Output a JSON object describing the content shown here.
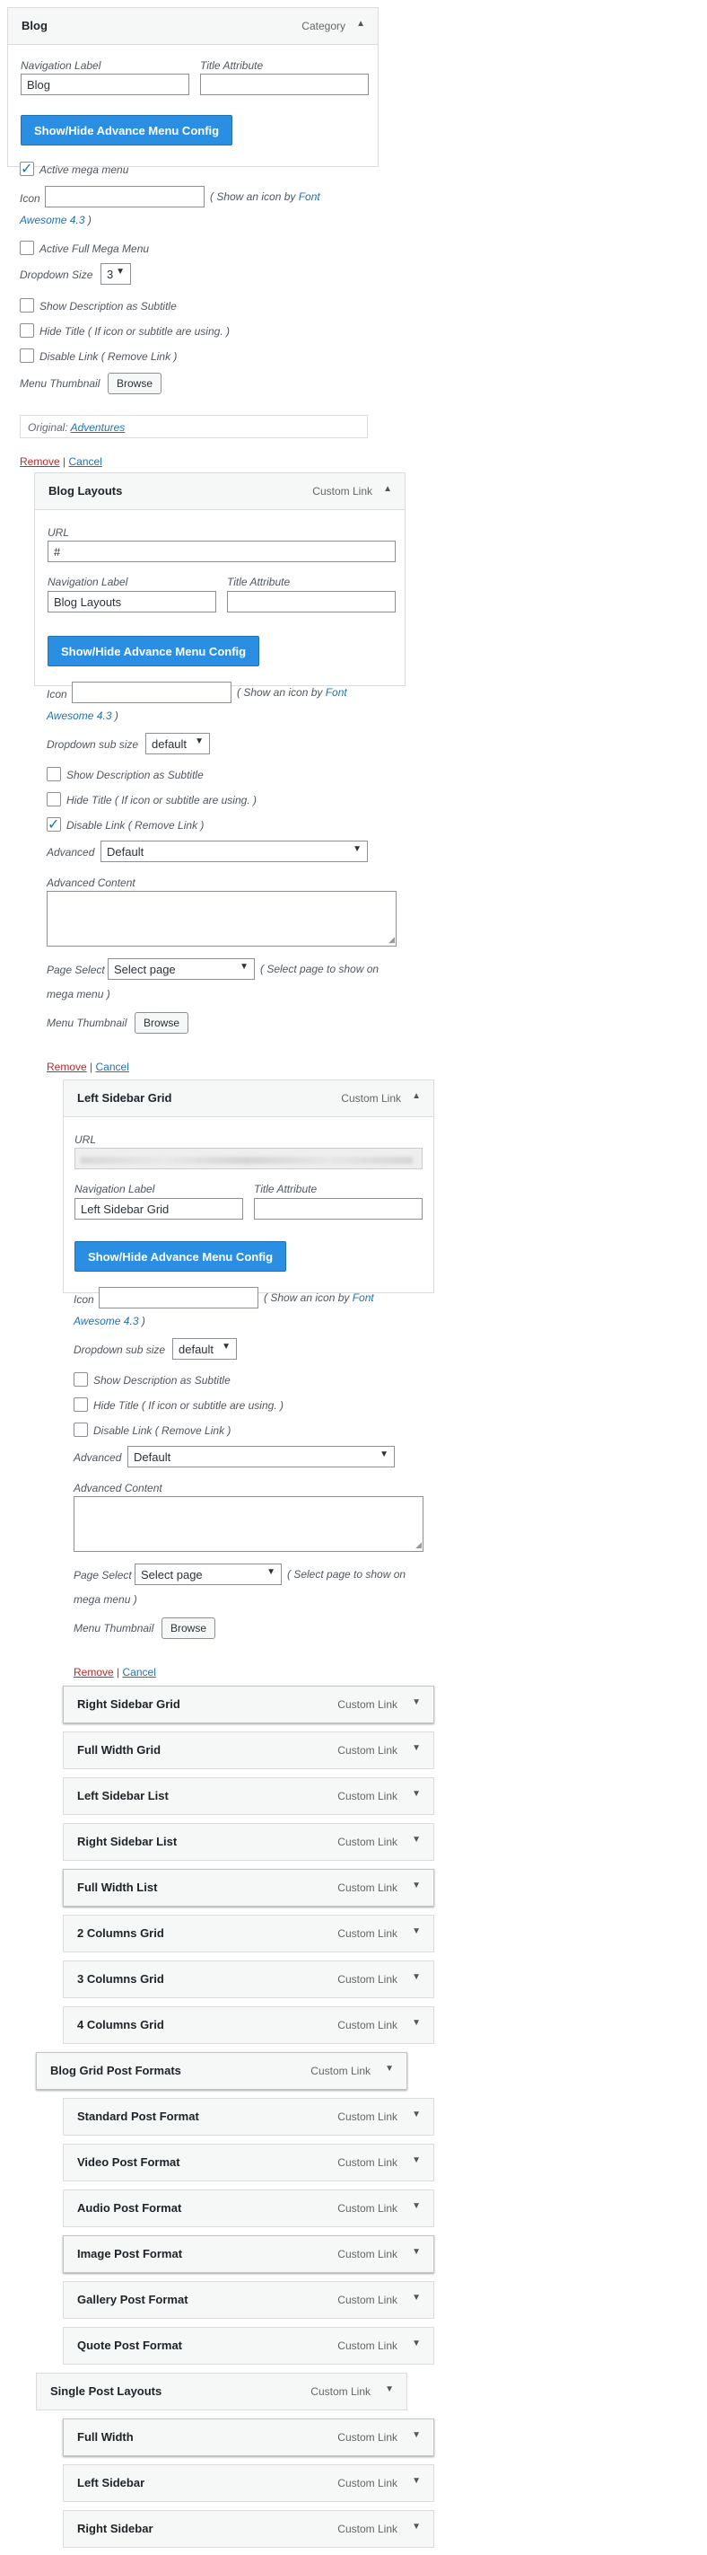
{
  "blog": {
    "title": "Blog",
    "type": "Category",
    "nav_label_lbl": "Navigation Label",
    "nav_label_val": "Blog",
    "title_attr_lbl": "Title Attribute",
    "title_attr_val": "",
    "toggle_btn": "Show/Hide Advance Menu Config",
    "active_mega": "Active mega menu",
    "icon_lbl": "Icon",
    "icon_hint_a": "( Show an icon by ",
    "icon_hint_link": "Font",
    "icon_hint_link2": "Awesome 4.3",
    "icon_hint_b": " )",
    "active_full": "Active Full Mega Menu",
    "dropdown_size_lbl": "Dropdown Size",
    "dropdown_size_val": "3",
    "show_desc": "Show Description as Subtitle",
    "hide_title": "Hide Title ( If icon or subtitle are using. )",
    "disable_link": "Disable Link ( Remove Link )",
    "thumb_lbl": "Menu Thumbnail",
    "browse": "Browse",
    "original_lbl": "Original:",
    "original_link": "Adventures",
    "remove": "Remove",
    "sep": "|",
    "cancel": "Cancel"
  },
  "blog_layouts": {
    "title": "Blog Layouts",
    "type": "Custom Link",
    "url_lbl": "URL",
    "url_val": "#",
    "nav_label_lbl": "Navigation Label",
    "nav_label_val": "Blog Layouts",
    "title_attr_lbl": "Title Attribute",
    "toggle_btn": "Show/Hide Advance Menu Config",
    "icon_lbl": "Icon",
    "icon_hint_a": "( Show an icon by ",
    "icon_hint_link": "Font",
    "icon_hint_link2": "Awesome 4.3",
    "icon_hint_b": " )",
    "dropdown_sub_lbl": "Dropdown sub size",
    "dropdown_sub_val": "default",
    "show_desc": "Show Description as Subtitle",
    "hide_title": "Hide Title ( If icon or subtitle are using. )",
    "disable_link": "Disable Link ( Remove Link )",
    "advanced_lbl": "Advanced",
    "advanced_val": "Default",
    "adv_content_lbl": "Advanced Content",
    "page_select_lbl": "Page Select",
    "page_select_val": "Select page",
    "page_select_hint": "( Select page to show on",
    "page_select_hint2": "mega menu )",
    "thumb_lbl": "Menu Thumbnail",
    "browse": "Browse",
    "remove": "Remove",
    "sep": "|",
    "cancel": "Cancel"
  },
  "left_sidebar_grid": {
    "title": "Left Sidebar Grid",
    "type": "Custom Link",
    "url_lbl": "URL",
    "nav_label_lbl": "Navigation Label",
    "nav_label_val": "Left Sidebar Grid",
    "title_attr_lbl": "Title Attribute",
    "toggle_btn": "Show/Hide Advance Menu Config",
    "icon_lbl": "Icon",
    "icon_hint_a": "( Show an icon by ",
    "icon_hint_link": "Font",
    "icon_hint_link2": "Awesome 4.3",
    "icon_hint_b": " )",
    "dropdown_sub_lbl": "Dropdown sub size",
    "dropdown_sub_val": "default",
    "show_desc": "Show Description as Subtitle",
    "hide_title": "Hide Title ( If icon or subtitle are using. )",
    "disable_link": "Disable Link ( Remove Link )",
    "advanced_lbl": "Advanced",
    "advanced_val": "Default",
    "adv_content_lbl": "Advanced Content",
    "page_select_lbl": "Page Select",
    "page_select_val": "Select page",
    "page_select_hint": "( Select page to show on",
    "page_select_hint2": "mega menu )",
    "thumb_lbl": "Menu Thumbnail",
    "browse": "Browse",
    "remove": "Remove",
    "sep": "|",
    "cancel": "Cancel"
  },
  "collapsed_items": [
    {
      "title": "Right Sidebar Grid",
      "type": "Custom Link"
    },
    {
      "title": "Full Width Grid",
      "type": "Custom Link"
    },
    {
      "title": "Left Sidebar List",
      "type": "Custom Link"
    },
    {
      "title": "Right Sidebar List",
      "type": "Custom Link"
    },
    {
      "title": "Full Width List",
      "type": "Custom Link"
    },
    {
      "title": "2 Columns Grid",
      "type": "Custom Link"
    },
    {
      "title": "3 Columns Grid",
      "type": "Custom Link"
    },
    {
      "title": "4 Columns Grid",
      "type": "Custom Link"
    },
    {
      "title": "Blog Grid Post Formats",
      "type": "Custom Link"
    },
    {
      "title": "Standard Post Format",
      "type": "Custom Link"
    },
    {
      "title": "Video Post Format",
      "type": "Custom Link"
    },
    {
      "title": "Audio Post Format",
      "type": "Custom Link"
    },
    {
      "title": "Image Post Format",
      "type": "Custom Link"
    },
    {
      "title": "Gallery Post Format",
      "type": "Custom Link"
    },
    {
      "title": "Quote Post Format",
      "type": "Custom Link"
    },
    {
      "title": "Single Post Layouts",
      "type": "Custom Link"
    },
    {
      "title": "Full Width",
      "type": "Custom Link"
    },
    {
      "title": "Left Sidebar",
      "type": "Custom Link"
    },
    {
      "title": "Right Sidebar",
      "type": "Custom Link"
    }
  ]
}
